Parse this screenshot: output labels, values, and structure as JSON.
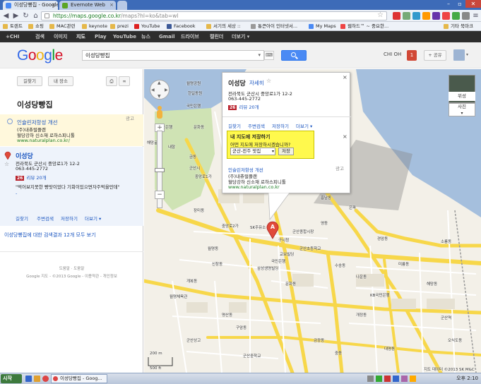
{
  "browser": {
    "tabs": [
      {
        "title": "이성당빵집 - Google 지도",
        "active": true
      },
      {
        "title": "Evernote Web",
        "active": false
      }
    ],
    "url_domain": "https://maps.google.co.kr",
    "url_path": "/maps?hl=ko&tab=wl",
    "bookmarks": [
      "토렌트",
      "쇼핑",
      "MAC관련",
      "keynote",
      "prezi",
      "YouTube",
      "Facebook",
      "서기의 세상 ::",
      "통큰아이 인터넷서...",
      "My Maps",
      "웹하드™ ~ 중요한...",
      "기타 북마크"
    ]
  },
  "gbar": {
    "items": [
      "+CHI",
      "검색",
      "이미지",
      "지도",
      "Play",
      "YouTube",
      "뉴스",
      "Gmail",
      "드라이브",
      "캘린더",
      "더보기 ▾"
    ],
    "active": "지도"
  },
  "header": {
    "logo": "Google",
    "search_value": "이성당빵집",
    "user": "CHI OH",
    "notifications": "1",
    "share": "+ 공유"
  },
  "left": {
    "btn_directions": "길찾기",
    "btn_myplaces": "내 장소",
    "title": "이성당빵집",
    "ad": {
      "label": "광고",
      "title": "인슐린저항성 개선",
      "line1": "(주)내츄럴플랜",
      "line2": "혈당강하 신소재 로하스피니톨",
      "url": "www.naturalplan.co.kr/"
    },
    "result": {
      "name": "이성당",
      "address": "전라북도 군산시 중앙로1가 12-2",
      "phone": "063-445-2772",
      "rating": "26",
      "reviews": "리뷰 20개",
      "snippet": "\"먹어보지못한 빵맛이었다 기회이있으면자주먹을만데\"",
      "links": [
        "길찾기",
        "주변검색",
        "저장하기",
        "더보기 ▾"
      ]
    },
    "more_results": "이성당빵집에 대한 검색결과 12개 모두 보기",
    "footer1": "도움말 · 도움말",
    "footer2": "Google 지도 - ©2013 Google - 이용약관 - 개인정보"
  },
  "infowin": {
    "title": "이성당",
    "details_link": "자세히",
    "address": "전라북도 군산시 중앙로1가 12-2",
    "phone": "063-445-2772",
    "rating": "26",
    "reviews": "리뷰 20개",
    "links": [
      "길찾기",
      "주변검색",
      "저장하기",
      "더보기 ▾"
    ],
    "save_title": "내 지도에 저장하기",
    "save_question": "어떤 지도에 저장하시겠습니까?",
    "save_select": "군산-전주 맛집",
    "save_button": "저장",
    "ad_label": "광고",
    "ad_title": "인슐린저항성 개선",
    "ad_line1": "(주)내츄럴플랜",
    "ad_line2": "혈당강하 신소재 로하스피니톨",
    "ad_url": "www.naturalplan.co.kr"
  },
  "map": {
    "sat_label": "위성",
    "photo_label": "사진",
    "scale_m": "200 m",
    "scale_ft": "500 ft",
    "copyright": "지도 데이터 ©2013 SK M&C",
    "marker": "A",
    "labels": [
      "월명공원",
      "한일동원",
      "국민은행",
      "문화동",
      "전북은행",
      "내항",
      "해망굴",
      "금동",
      "군산시",
      "중앙로1가",
      "SK주유소",
      "구시청",
      "교보빌딩",
      "국민은행",
      "삼성생명빌딩",
      "월명동",
      "군산종합시장",
      "흥남동",
      "장미동",
      "군산초등학교",
      "은파",
      "영동",
      "신창동",
      "경암동",
      "개복동",
      "중앙로2가",
      "명산동",
      "구암동",
      "문화동",
      "나운동",
      "수송동",
      "미룡동",
      "해망동",
      "개정동",
      "군산역",
      "KB국민은행",
      "군산중학교",
      "월명체육관",
      "금광동",
      "중동",
      "대명동",
      "군산상고",
      "소룡동",
      "오식도동"
    ]
  },
  "taskbar": {
    "start": "시작",
    "task": "이성당빵집 - Goog...",
    "clock": "오후 2:10"
  }
}
